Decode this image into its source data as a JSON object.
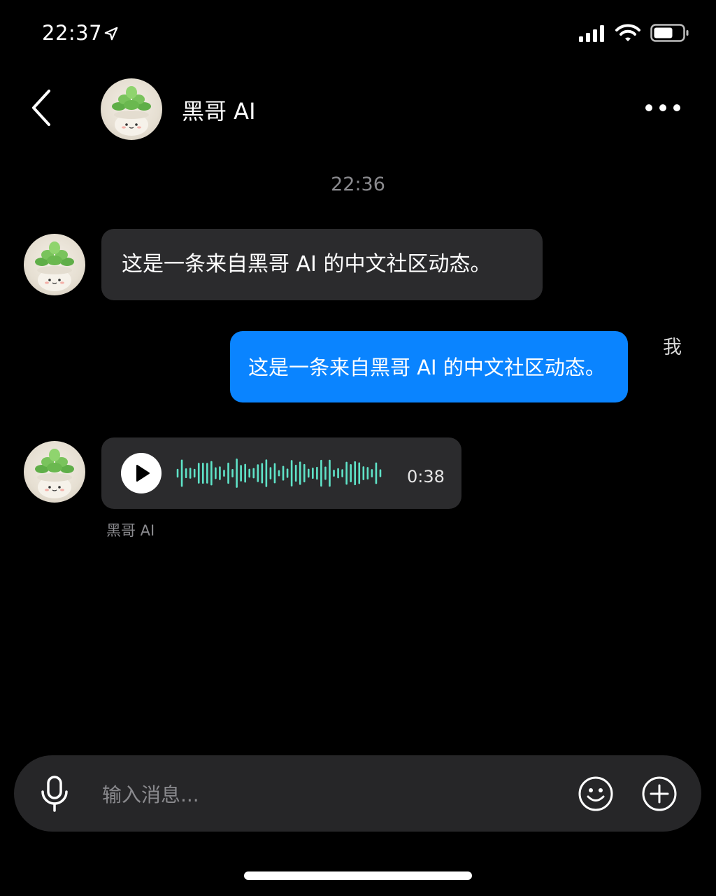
{
  "status_bar": {
    "time": "22:37"
  },
  "header": {
    "title": "黑哥 AI"
  },
  "chat": {
    "timestamp": "22:36",
    "messages": [
      {
        "from": "bot",
        "text": "这是一条来自黑哥 AI 的中文社区动态。"
      },
      {
        "from": "me",
        "sender_label": "我",
        "text": "这是一条来自黑哥 AI 的中文社区动态。"
      },
      {
        "from": "bot",
        "type": "voice",
        "duration": "0:38",
        "sender_label": "黑哥 AI"
      }
    ]
  },
  "composer": {
    "placeholder": "输入消息..."
  },
  "colors": {
    "background": "#000000",
    "incoming_bubble": "#2b2b2d",
    "outgoing_bubble": "#0a84ff",
    "waveform": "#5fe3c8",
    "composer": "#262628"
  },
  "icons": [
    "location-arrow-icon",
    "signal-icon",
    "wifi-icon",
    "battery-icon",
    "back-chevron-icon",
    "more-dots-icon",
    "play-icon",
    "waveform-icon",
    "microphone-icon",
    "emoji-icon",
    "plus-circle-icon"
  ]
}
